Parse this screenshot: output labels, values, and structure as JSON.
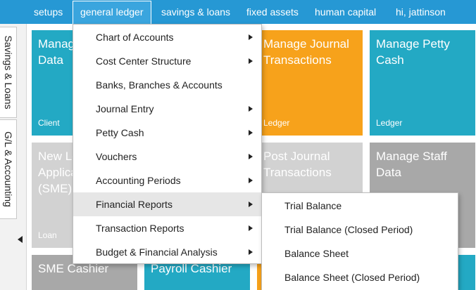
{
  "nav": {
    "setups": "setups",
    "general_ledger": "general ledger",
    "savings_loans": "savings & loans",
    "fixed_assets": "fixed assets",
    "human_capital": "human capital",
    "user": "hi, jattinson",
    "bar_color": "#2698d4"
  },
  "sidebar": {
    "tabs": [
      "Savings & Loans",
      "G/L & Accounting"
    ]
  },
  "tiles": [
    {
      "title": "Manage Client\nData",
      "caption": "Client",
      "color": "#23a9c4"
    },
    {
      "title": "Manage Journal\nTransactions",
      "caption": "Ledger",
      "color": "#f7a21b"
    },
    {
      "title": "Manage Petty\nCash",
      "caption": "Ledger",
      "color": "#23a9c4"
    },
    {
      "title": "New Loan\nApplication\n(SME)",
      "caption": "Loan",
      "color": "#d2d2d2"
    },
    {
      "title": "Post Journal\nTransactions",
      "caption": "",
      "color": "#d2d2d2"
    },
    {
      "title": "Manage Staff\nData",
      "caption": "",
      "color": "#a8a8a8"
    },
    {
      "title": "SME Cashier",
      "caption": "",
      "color": "#a8a8a8"
    },
    {
      "title": "Payroll Cashier",
      "caption": "",
      "color": "#23a9c4"
    }
  ],
  "menu": {
    "items": [
      {
        "label": "Chart of Accounts",
        "has_submenu": true
      },
      {
        "label": "Cost Center Structure",
        "has_submenu": true
      },
      {
        "label": "Banks, Branches & Accounts",
        "has_submenu": false
      },
      {
        "label": "Journal Entry",
        "has_submenu": true
      },
      {
        "label": "Petty Cash",
        "has_submenu": true
      },
      {
        "label": "Vouchers",
        "has_submenu": true
      },
      {
        "label": "Accounting Periods",
        "has_submenu": true
      },
      {
        "label": "Financial Reports",
        "has_submenu": true,
        "highlighted": true
      },
      {
        "label": "Transaction Reports",
        "has_submenu": true
      },
      {
        "label": "Budget & Financial Analysis",
        "has_submenu": true
      }
    ]
  },
  "submenu": {
    "items": [
      {
        "label": "Trial Balance"
      },
      {
        "label": "Trial Balance (Closed Period)"
      },
      {
        "label": "Balance Sheet"
      },
      {
        "label": "Balance Sheet (Closed Period)"
      }
    ]
  }
}
